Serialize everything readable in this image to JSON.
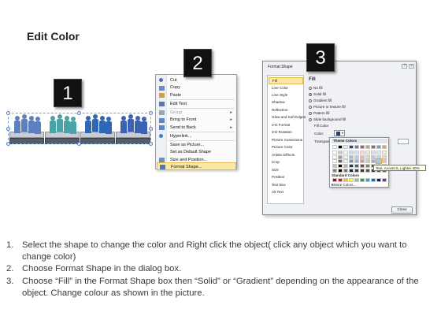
{
  "title": "Edit Color",
  "badges": [
    "1",
    "2",
    "3"
  ],
  "context_menu": {
    "items": [
      {
        "label": "Cut",
        "icon": "scissors-icon",
        "color": "#4b6ea8",
        "disabled": false,
        "arrow": ""
      },
      {
        "label": "Copy",
        "icon": "copy-icon",
        "color": "#6b8cc4",
        "disabled": false,
        "arrow": ""
      },
      {
        "label": "Paste",
        "icon": "paste-icon",
        "color": "#c7a24a",
        "disabled": false,
        "arrow": ""
      },
      {
        "label": "Edit Text",
        "icon": "edit-text-icon",
        "color": "#5a76a8",
        "disabled": false,
        "arrow": ""
      },
      {
        "label": "Group",
        "icon": "group-icon",
        "color": "#9aa3b0",
        "disabled": true,
        "arrow": "▸"
      },
      {
        "label": "Bring to Front",
        "icon": "bring-front-icon",
        "color": "#5f86c2",
        "disabled": false,
        "arrow": "▸"
      },
      {
        "label": "Send to Back",
        "icon": "send-back-icon",
        "color": "#5f86c2",
        "disabled": false,
        "arrow": "▸"
      },
      {
        "label": "Hyperlink...",
        "icon": "hyperlink-icon",
        "color": "#3b7fd0",
        "disabled": false,
        "arrow": ""
      },
      {
        "label": "Save as Picture...",
        "icon": "",
        "color": "",
        "disabled": false,
        "arrow": ""
      },
      {
        "label": "Set as Default Shape",
        "icon": "",
        "color": "",
        "disabled": false,
        "arrow": ""
      },
      {
        "label": "Size and Position...",
        "icon": "size-position-icon",
        "color": "#6f8db8",
        "disabled": false,
        "arrow": ""
      },
      {
        "label": "Format Shape...",
        "icon": "format-shape-icon",
        "color": "#4a7ac0",
        "disabled": false,
        "arrow": ""
      }
    ]
  },
  "dialog": {
    "title": "Format Shape",
    "nav": [
      "Fill",
      "Line Color",
      "Line Style",
      "Shadow",
      "Reflection",
      "Glow and Soft Edges",
      "3-D Format",
      "3-D Rotation",
      "Picture Corrections",
      "Picture Color",
      "Artistic Effects",
      "Crop",
      "Size",
      "Position",
      "Text Box",
      "Alt Text"
    ],
    "fill_heading": "Fill",
    "fill_options": [
      "No fill",
      "Solid fill",
      "Gradient fill",
      "Picture or texture fill",
      "Pattern fill",
      "Slide background fill"
    ],
    "fill_selected": 1,
    "fill_color_label": "Fill Color",
    "color_label": "Color:",
    "transparency_label": "Transparency:",
    "close_label": "Close"
  },
  "palette": {
    "theme_heading": "Theme Colors",
    "standard_heading": "Standard Colors",
    "more_colors": "More Colors...",
    "tooltip": "Text, Accent 5, Lighter 40%",
    "theme_top": [
      "#ffffff",
      "#000000",
      "#eeece1",
      "#1f497d",
      "#4f81bd",
      "#c0504d",
      "#9bbb59",
      "#8064a2",
      "#4bacc6",
      "#f79646"
    ],
    "standard": [
      "#c00000",
      "#ff0000",
      "#ffc000",
      "#ffff00",
      "#92d050",
      "#00b050",
      "#00b0f0",
      "#0070c0",
      "#002060",
      "#7030a0"
    ]
  },
  "instructions": [
    {
      "num": "1.",
      "text": "Select the shape to change the color and Right click the object( click any object which you want to change color)"
    },
    {
      "num": "2.",
      "text": "Choose Format Shape in the dialog box."
    },
    {
      "num": "3.",
      "text": "Choose “Fill” in the Format Shape box then “Solid” or “Gradient” depending on the appearance of the object. Change colour as shown in the picture."
    }
  ],
  "shape_colors": [
    "#5b7fbf",
    "#4aa3a6",
    "#2f67b6",
    "#3c62b4"
  ]
}
